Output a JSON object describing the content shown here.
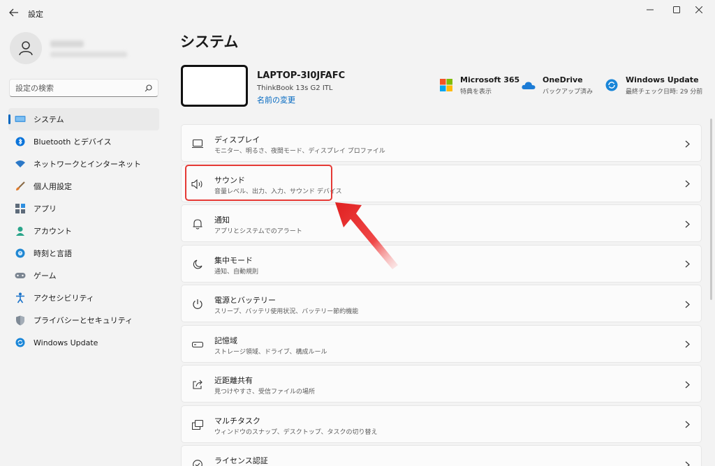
{
  "window": {
    "title": "設定",
    "controls": [
      "minimize",
      "maximize",
      "close"
    ]
  },
  "sidebar": {
    "search_placeholder": "設定の検索",
    "items": [
      {
        "label": "システム",
        "icon": "monitor-icon",
        "active": true
      },
      {
        "label": "Bluetooth とデバイス",
        "icon": "bluetooth-icon"
      },
      {
        "label": "ネットワークとインターネット",
        "icon": "wifi-icon"
      },
      {
        "label": "個人用設定",
        "icon": "brush-icon"
      },
      {
        "label": "アプリ",
        "icon": "apps-icon"
      },
      {
        "label": "アカウント",
        "icon": "account-icon"
      },
      {
        "label": "時刻と言語",
        "icon": "globe-clock-icon"
      },
      {
        "label": "ゲーム",
        "icon": "gamepad-icon"
      },
      {
        "label": "アクセシビリティ",
        "icon": "accessibility-icon"
      },
      {
        "label": "プライバシーとセキュリティ",
        "icon": "shield-icon"
      },
      {
        "label": "Windows Update",
        "icon": "update-icon"
      }
    ]
  },
  "main": {
    "title": "システム",
    "device": {
      "name": "LAPTOP-3I0JFAFC",
      "model": "ThinkBook 13s G2 ITL",
      "rename": "名前の変更"
    },
    "quick": [
      {
        "title": "Microsoft 365",
        "sub": "特典を表示",
        "icon": "microsoft-logo-icon"
      },
      {
        "title": "OneDrive",
        "sub": "バックアップ済み",
        "icon": "cloud-icon"
      },
      {
        "title": "Windows Update",
        "sub": "最終チェック日時: 29 分前",
        "icon": "update-icon"
      }
    ],
    "rows": [
      {
        "title": "ディスプレイ",
        "sub": "モニター、明るさ、夜間モード、ディスプレイ プロファイル",
        "icon": "display-icon"
      },
      {
        "title": "サウンド",
        "sub": "音量レベル、出力、入力、サウンド デバイス",
        "icon": "speaker-icon"
      },
      {
        "title": "通知",
        "sub": "アプリとシステムでのアラート",
        "icon": "bell-icon"
      },
      {
        "title": "集中モード",
        "sub": "通知、自動規則",
        "icon": "moon-icon"
      },
      {
        "title": "電源とバッテリー",
        "sub": "スリープ、バッテリ使用状況、バッテリー節約機能",
        "icon": "power-icon"
      },
      {
        "title": "記憶域",
        "sub": "ストレージ領域、ドライブ、構成ルール",
        "icon": "storage-icon"
      },
      {
        "title": "近距離共有",
        "sub": "見つけやすさ、受信ファイルの場所",
        "icon": "share-icon"
      },
      {
        "title": "マルチタスク",
        "sub": "ウィンドウのスナップ、デスクトップ、タスクの切り替え",
        "icon": "multitask-icon"
      },
      {
        "title": "ライセンス認証",
        "sub": "",
        "icon": "check-circle-icon"
      }
    ]
  },
  "colors": {
    "accent": "#0067c0",
    "highlight": "#e53935"
  }
}
